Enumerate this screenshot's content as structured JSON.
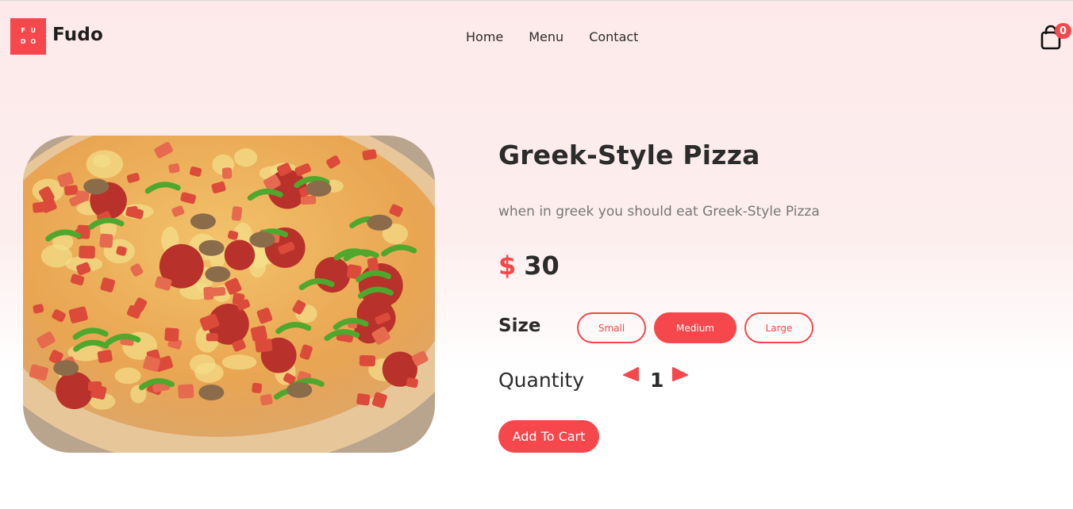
{
  "header": {
    "logo_letters": [
      "F",
      "U",
      "D",
      "O"
    ],
    "brand": "Fudo",
    "nav": [
      {
        "label": "Home"
      },
      {
        "label": "Menu"
      },
      {
        "label": "Contact"
      }
    ],
    "cart_count": "0",
    "cart_icon": "shopping-bag-icon"
  },
  "product": {
    "image_alt": "Greek-Style Pizza",
    "title": "Greek-Style Pizza",
    "description": "when in greek you should eat Greek-Style Pizza",
    "currency": "$",
    "price": "30",
    "size_label": "Size",
    "sizes": [
      {
        "label": "Small",
        "selected": false
      },
      {
        "label": "Medium",
        "selected": true
      },
      {
        "label": "Large",
        "selected": false
      }
    ],
    "quantity_label": "Quantity",
    "quantity": "1",
    "decrease_icon": "arrow-left-icon",
    "increase_icon": "arrow-right-icon",
    "add_to_cart_label": "Add To Cart"
  },
  "colors": {
    "accent": "#f5474c",
    "text_dark": "#2b2b2b",
    "text_muted": "#777777",
    "bg_top": "#fde9ea"
  }
}
